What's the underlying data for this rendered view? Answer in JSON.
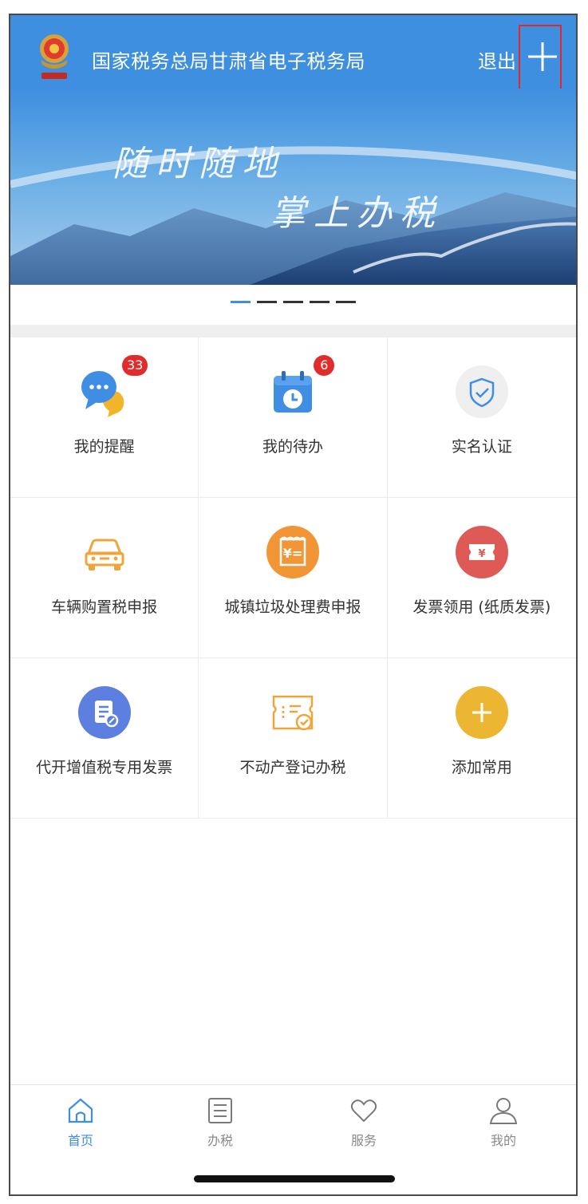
{
  "header": {
    "title": "国家税务总局甘肃省电子税务局",
    "logout_label": "退出",
    "logo_icon": "china-tax-emblem"
  },
  "banner": {
    "line1": "随时随地",
    "line2": "掌上办税",
    "slides_count": 5,
    "active_slide": 1
  },
  "grid": [
    {
      "label": "我的提醒",
      "icon": "chat-bubbles-icon",
      "badge": "33"
    },
    {
      "label": "我的待办",
      "icon": "calendar-clock-icon",
      "badge": "6"
    },
    {
      "label": "实名认证",
      "icon": "shield-check-icon"
    },
    {
      "label": "车辆购置税申报",
      "icon": "car-icon"
    },
    {
      "label": "城镇垃圾处理费申报",
      "icon": "receipt-yen-icon"
    },
    {
      "label": "发票领用 (纸质发票)",
      "icon": "ticket-yen-icon"
    },
    {
      "label": "代开增值税专用发票",
      "icon": "document-edit-icon"
    },
    {
      "label": "不动产登记办税",
      "icon": "ticket-list-check-icon"
    },
    {
      "label": "添加常用",
      "icon": "add-icon"
    }
  ],
  "tabs": [
    {
      "label": "首页",
      "icon": "home-icon",
      "active": true
    },
    {
      "label": "办税",
      "icon": "list-icon",
      "active": false
    },
    {
      "label": "服务",
      "icon": "heart-icon",
      "active": false
    },
    {
      "label": "我的",
      "icon": "person-icon",
      "active": false
    }
  ],
  "colors": {
    "primary": "#3e8fe0",
    "badge": "#e12d2a",
    "highlight": "#e6262a"
  }
}
